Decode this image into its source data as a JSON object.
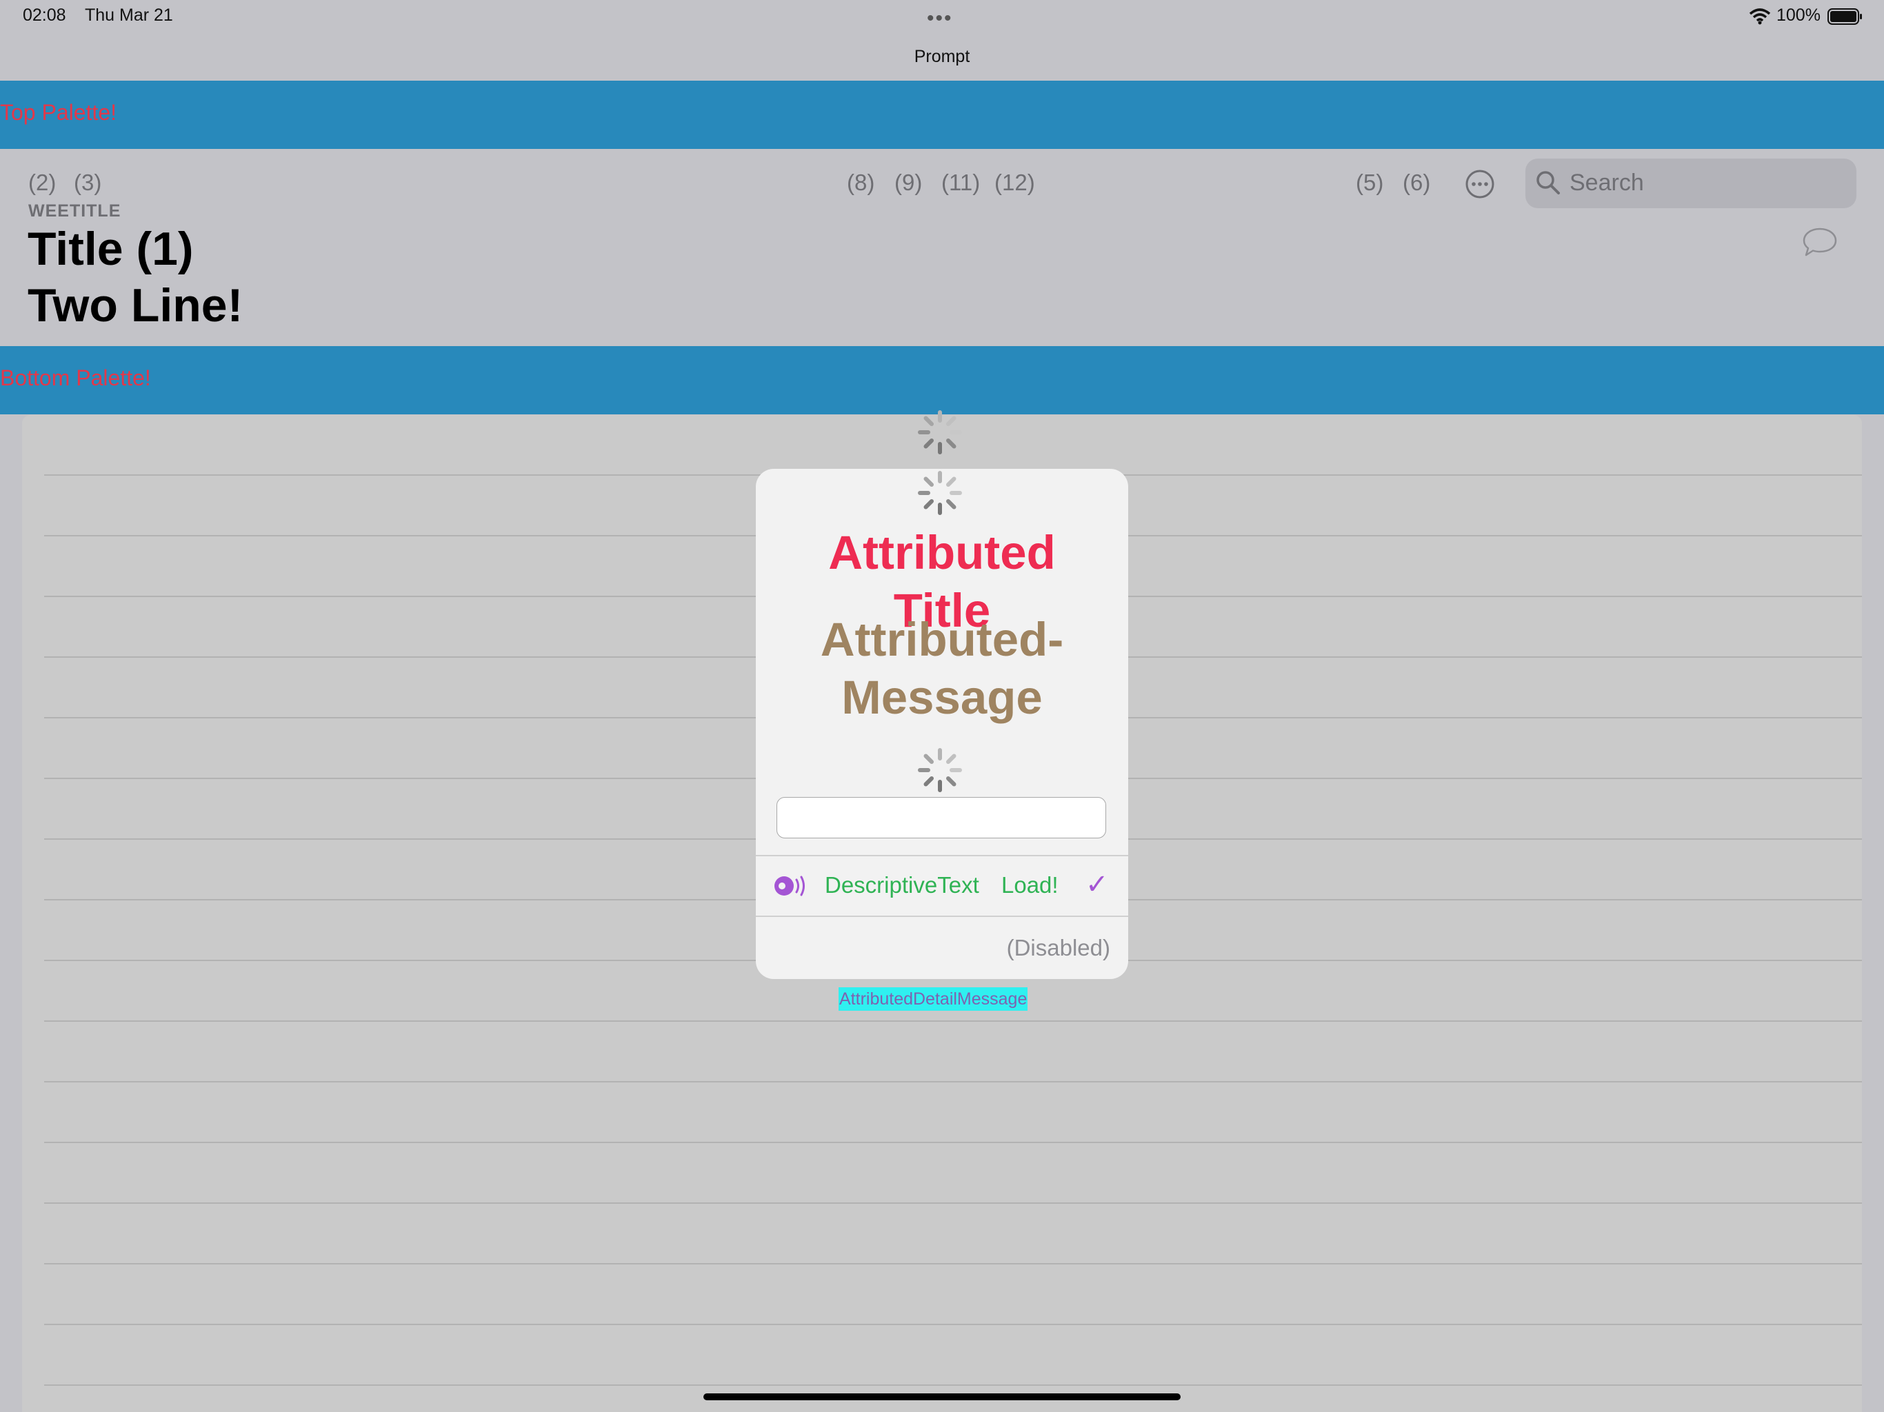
{
  "status_bar": {
    "time": "02:08",
    "date": "Thu Mar 21",
    "dots": "•••",
    "battery": "100%"
  },
  "nav": {
    "prompt": "Prompt",
    "top_palette": "Top Palette!",
    "bottom_palette": "Bottom Palette!",
    "left_items": [
      "(2)",
      "(3)"
    ],
    "center_items": [
      "(8)",
      "(9)",
      "(11)",
      "(12)"
    ],
    "right_items": [
      "(5)",
      "(6)"
    ],
    "wee_title": "WEETITLE",
    "title_line1": "Title (1)",
    "title_line2": "Two Line!",
    "search_placeholder": "Search"
  },
  "alert": {
    "title_line1": "Attributed",
    "title_line2": "Title",
    "message_line1": "Attributed-",
    "message_line2": "Message",
    "text_field_value": "",
    "action_descriptive": "DescriptiveText",
    "action_load": "Load!",
    "checkmark": "✓",
    "disabled_label": "(Disabled)",
    "detail_message": "AttributedDetailMessage"
  },
  "colors": {
    "palette": "#2889bb",
    "palette_text": "#e2384a",
    "title": "#ee2c52",
    "message": "#9f8461",
    "action": "#2fb354",
    "check": "#a455d4",
    "detail_bg": "#2ff0f0"
  },
  "icons": {
    "wifi": "wifi-icon",
    "battery": "battery-icon",
    "more": "ellipsis-circle-icon",
    "search": "magnifier-icon",
    "comment": "speech-bubble-icon",
    "spinner": "activity-spinner-icon",
    "action": "audio-broadcast-icon"
  }
}
